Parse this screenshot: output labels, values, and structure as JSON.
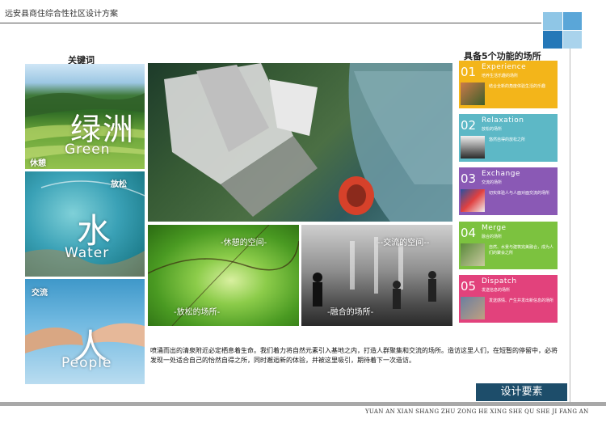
{
  "header": {
    "title": "远安县商住综合性社区设计方案"
  },
  "keywords": {
    "heading": "关键词",
    "panels": [
      {
        "big": "绿洲",
        "en": "Green",
        "label": "休憩"
      },
      {
        "big": "水",
        "en": "Water",
        "label": "放松"
      },
      {
        "big": "人",
        "en": "People",
        "label": "交流"
      }
    ]
  },
  "functions": {
    "heading": "具备5个功能的场所",
    "cards": [
      {
        "num": "01",
        "en": "Experience",
        "cn": "培养生活乐趣的场所",
        "desc": "结合全新的角度体验生活的乐趣",
        "color": "#f3b51a"
      },
      {
        "num": "02",
        "en": "Relaxation",
        "cn": "放松的场所",
        "desc": "悠然自得的放松之所",
        "color": "#5db8c6"
      },
      {
        "num": "03",
        "en": "Exchange",
        "cn": "交流的场所",
        "desc": "切实体验人与人面对面交流的场所",
        "color": "#8a59b5"
      },
      {
        "num": "04",
        "en": "Merge",
        "cn": "融合的场所",
        "desc": "自然、水景与建筑完美融合，成为人们的聚会之所",
        "color": "#7cc23f"
      },
      {
        "num": "05",
        "en": "Dispatch",
        "cn": "发送信息的场所",
        "desc": "发送感情、产生并发出新信息的场所",
        "color": "#e2427c"
      }
    ]
  },
  "photos": {
    "green": {
      "label_top": "-休憩的空间-",
      "label_bottom": "-放松的场所-"
    },
    "bw": {
      "label_top": "--交流的空间--",
      "label_bottom": "-融合的场所-"
    }
  },
  "paragraph": "喷涌而出的清泉附近必定栖息着生命。我们着力将自然元素引入基地之内，打造人群聚集和交流的场所。造访这里人们，在短暂的停留中，必将发现一处适合自己的怡然自得之所，同时邂逅新的体验，并被这里吸引，期待着下一次造访。",
  "banner": "设计要素",
  "footer": "YUAN AN XIAN SHANG ZHU ZONG HE XING SHE QU SHE JI FANG AN",
  "colors": {
    "accent_blue": "#1d4d6a",
    "sq_light": "#8fc6e6",
    "sq_mid": "#5aa6d8",
    "sq_dark": "#2578b8"
  }
}
